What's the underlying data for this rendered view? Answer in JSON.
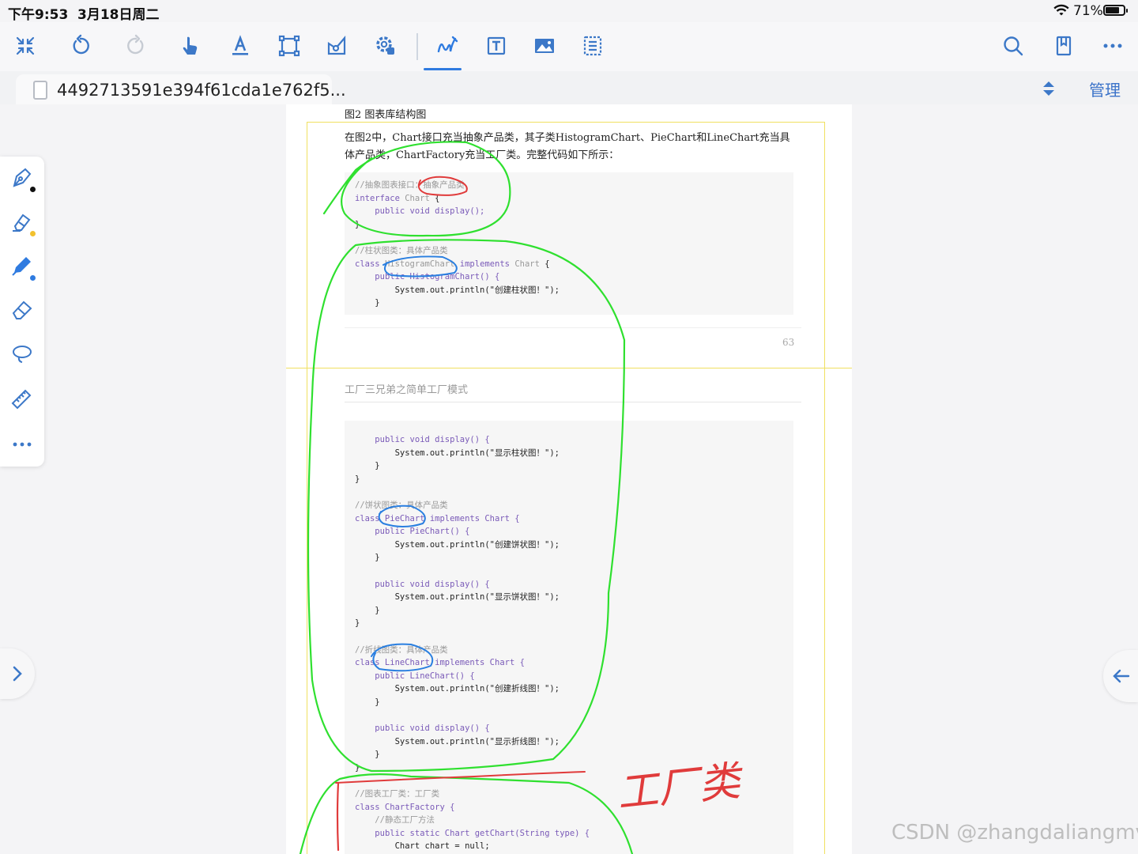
{
  "status_bar": {
    "time": "下午9:53",
    "date": "3月18日周二",
    "battery": "71%"
  },
  "toolbar": {
    "items": [
      {
        "name": "collapse-icon"
      },
      {
        "name": "undo-icon"
      },
      {
        "name": "redo-icon"
      },
      {
        "name": "hand-pointer-icon"
      },
      {
        "name": "text-underline-icon"
      },
      {
        "name": "select-rectangle-icon"
      },
      {
        "name": "shape-tool-icon"
      },
      {
        "name": "settings-gear-icon"
      },
      {
        "name": "handwriting-pen-icon",
        "active": true
      },
      {
        "name": "text-box-icon"
      },
      {
        "name": "image-icon"
      },
      {
        "name": "list-icon"
      }
    ],
    "right_items": [
      {
        "name": "search-icon"
      },
      {
        "name": "bookmark-icon"
      },
      {
        "name": "more-icon"
      }
    ],
    "accent_color": "#2f7be0"
  },
  "tab": {
    "title": "4492713591e394f61cda1e762f5...",
    "manage_label": "管理"
  },
  "side_tools": [
    {
      "name": "fountain-pen-icon",
      "dot_color": "#111111"
    },
    {
      "name": "highlighter-icon",
      "dot_color": "#f2c12e"
    },
    {
      "name": "marker-pen-icon",
      "dot_color": "#2f7be0"
    },
    {
      "name": "eraser-icon"
    },
    {
      "name": "lasso-icon"
    },
    {
      "name": "ruler-icon"
    },
    {
      "name": "more-tools-icon"
    }
  ],
  "document": {
    "figure_caption": "图2 图表库结构图",
    "paragraph": "在图2中，Chart接口充当抽象产品类，其子类HistogramChart、PieChart和LineChart充当具体产品类，ChartFactory充当工厂类。完整代码如下所示：",
    "page_number": "63",
    "running_head": "工厂三兄弟之简单工厂模式",
    "code_block_1": {
      "comment_1": "//抽象图表接口：抽象产品类",
      "line_interface_kw": "interface",
      "line_interface_type": "Chart",
      "line_interface_end": "{",
      "display_decl": "public void display();",
      "close_brace": "}",
      "comment_2": "//柱状图类：具体产品类",
      "class_kw": "class",
      "class_name": "HistogramChart",
      "implements_kw": "implements",
      "iface": "Chart",
      "ctor": "public HistogramChart() {",
      "println_1": "System.out.println(\"创建柱状图！\");",
      "inner_close": "}"
    },
    "code_block_2": {
      "display_1": "public void display() {",
      "println_show_hist": "System.out.println(\"显示柱状图！\");",
      "comment_pie": "//饼状图类：具体产品类",
      "pie_class": "class PieChart implements Chart {",
      "pie_ctor": "public PieChart() {",
      "println_create_pie": "System.out.println(\"创建饼状图！\");",
      "display_2": "public void display() {",
      "println_show_pie": "System.out.println(\"显示饼状图！\");",
      "comment_line": "//折线图类：具体产品类",
      "line_class": "class LineChart implements Chart {",
      "line_ctor": "public LineChart() {",
      "println_create_line": "System.out.println(\"创建折线图！\");",
      "display_3": "public void display() {",
      "println_show_line": "System.out.println(\"显示折线图！\");",
      "comment_factory": "//图表工厂类：工厂类",
      "factory_class": "class ChartFactory {",
      "comment_static": "//静态工厂方法",
      "getchart": "public static Chart getChart(String type) {",
      "chart_null": "Chart chart = null;"
    }
  },
  "annotation": {
    "handwritten_text": "工厂类",
    "ink_green": "#2fe02f",
    "ink_red": "#e03b3b",
    "ink_blue": "#2a7fe0"
  },
  "watermark": "CSDN @zhangdaliangmvp"
}
